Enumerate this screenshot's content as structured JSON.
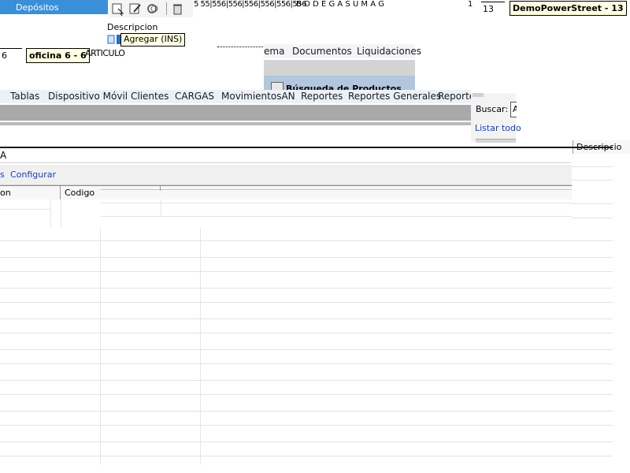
{
  "header": {
    "title": "Depósitos"
  },
  "toolbar": {
    "field_label": "Descripcion",
    "tooltip_add": "Agregar (INS)"
  },
  "glitch": {
    "top_numbers": "5   55|556|556|556|556|556|556",
    "top_letters": "B  O  D  E  G  A  S  U  M  A  G",
    "top_num2": "1",
    "field_13": "13",
    "field_6": "6",
    "articulo": "ARTICULO"
  },
  "tooltips": {
    "demo_power_street": "DemoPowerStreet - 13",
    "oficina": "oficina 6 - 6"
  },
  "top_menu": {
    "items": [
      "ema",
      "Documentos",
      "Liquidaciones"
    ]
  },
  "product_search": {
    "title": "Búsqueda de Productos"
  },
  "main_menu": {
    "items": [
      "Tablas",
      "Dispositivo Móvil",
      "Clientes",
      "CARGAS",
      "MovimientosAN",
      "Reportes",
      "Reportes Generales",
      "Reporte"
    ]
  },
  "search_panel": {
    "label": "Buscar:",
    "value": "A",
    "list_all": "Listar todo"
  },
  "right_header": {
    "label": "Descripcio"
  },
  "filter": {
    "value": "A"
  },
  "actions": {
    "left_partial": "s",
    "configure": "Configurar"
  },
  "grid": {
    "columns": [
      "on",
      "Codigo"
    ]
  }
}
